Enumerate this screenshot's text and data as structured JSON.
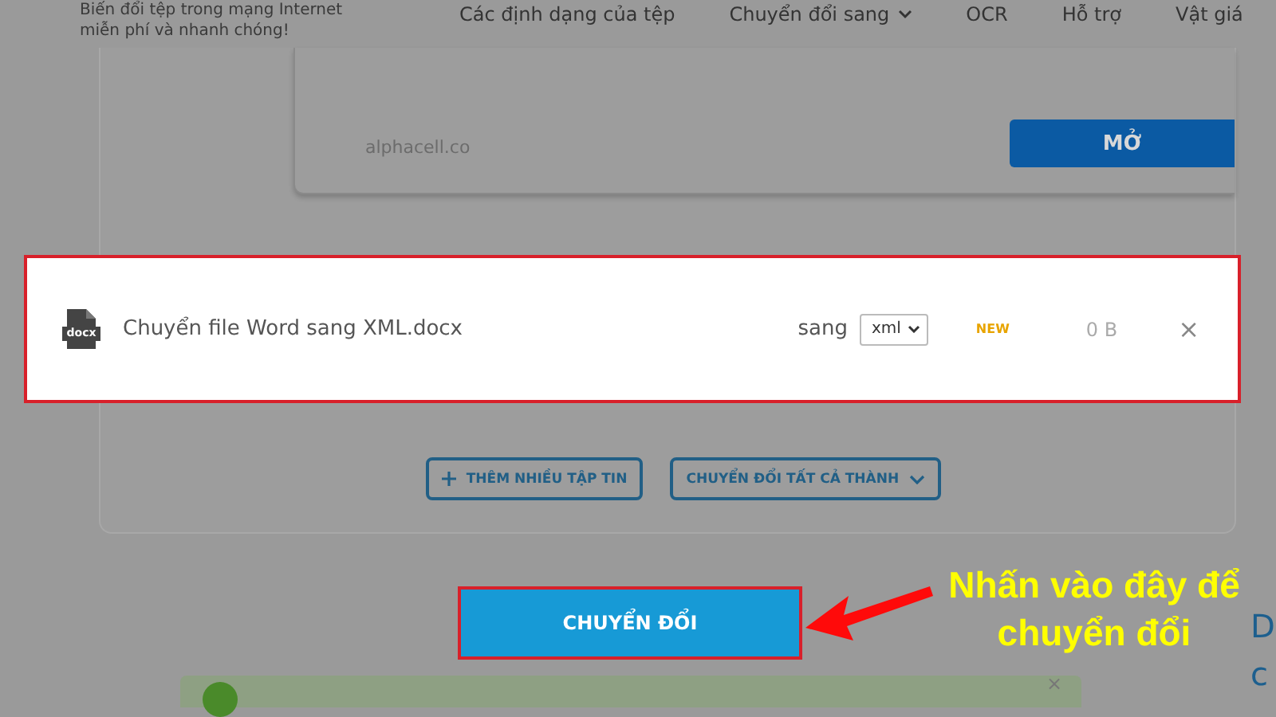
{
  "header": {
    "tagline": [
      "Biến đổi tệp trong mạng Internet",
      "miễn phí và nhanh chóng!"
    ],
    "nav": [
      {
        "label": "Các định dạng của tệp",
        "dropdown": false
      },
      {
        "label": "Chuyển đổi sang",
        "dropdown": true
      },
      {
        "label": "OCR",
        "dropdown": false
      },
      {
        "label": "Hỗ trợ",
        "dropdown": false
      },
      {
        "label": "Vật giá",
        "dropdown": false
      }
    ]
  },
  "ad_card": {
    "domain": "alphacell.co",
    "button": "MỞ"
  },
  "file_row": {
    "icon_label": "docx",
    "name": "Chuyển file Word sang XML.docx",
    "to_label": "sang",
    "format": "xml",
    "badge": "NEW",
    "size": "0 B",
    "remove": "×"
  },
  "actions": [
    {
      "label": "THÊM NHIỀU TẬP TIN",
      "kind": "add"
    },
    {
      "label": "CHUYỂN ĐỔI TẤT CẢ THÀNH",
      "kind": "dropdown"
    }
  ],
  "convert_button": "CHUYỂN ĐỔI",
  "annotation": [
    "Nhấn vào đây để",
    "chuyển đổi"
  ],
  "side_text": [
    "D",
    "c"
  ],
  "notice": {
    "close": "×"
  }
}
